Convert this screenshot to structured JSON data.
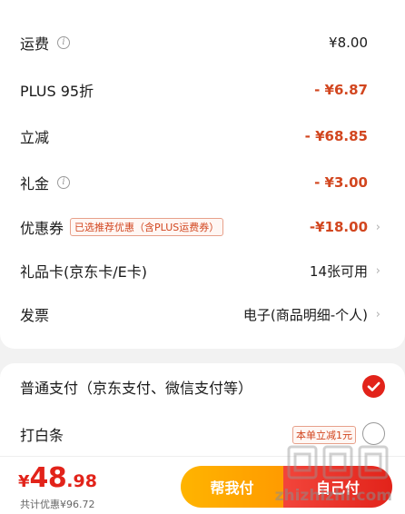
{
  "order_summary": {
    "rows": [
      {
        "label": "运费",
        "value": "¥8.00",
        "value_style": "black",
        "has_info": true,
        "has_chevron": false
      },
      {
        "label": "PLUS 95折",
        "value": "- ¥6.87",
        "value_style": "red",
        "has_info": false,
        "has_chevron": false
      },
      {
        "label": "立减",
        "value": "- ¥68.85",
        "value_style": "red",
        "has_info": false,
        "has_chevron": false
      },
      {
        "label": "礼金",
        "value": "- ¥3.00",
        "value_style": "red",
        "has_info": true,
        "has_chevron": false
      },
      {
        "label": "优惠券",
        "tag": "已选推荐优惠（含PLUS运费券）",
        "value": "-¥18.00",
        "value_style": "red",
        "has_info": false,
        "has_chevron": true
      },
      {
        "label": "礼品卡(京东卡/E卡)",
        "value": "14张可用",
        "value_style": "black",
        "has_info": false,
        "has_chevron": true
      },
      {
        "label": "发票",
        "value": "电子(商品明细-个人)",
        "value_style": "black",
        "has_info": false,
        "has_chevron": true
      }
    ],
    "info_icon": "info-icon",
    "chevron": "›"
  },
  "payment": {
    "options": [
      {
        "label": "普通支付（京东支付、微信支付等）",
        "selected": true
      },
      {
        "label": "打白条",
        "selected": false,
        "tag": "本单立减1元"
      }
    ]
  },
  "bottom_bar": {
    "currency": "¥",
    "price_int": "48",
    "price_dec": ".98",
    "saved_prefix": "共计优惠",
    "saved_amount": "¥96.72",
    "help_button": "帮我付",
    "self_button": "自己付"
  },
  "watermark": {
    "text": "zhizhizhi.com"
  },
  "colors": {
    "accent_red": "#e2231a",
    "discount_red": "#d2461f",
    "help_orange": "#ffa800"
  }
}
